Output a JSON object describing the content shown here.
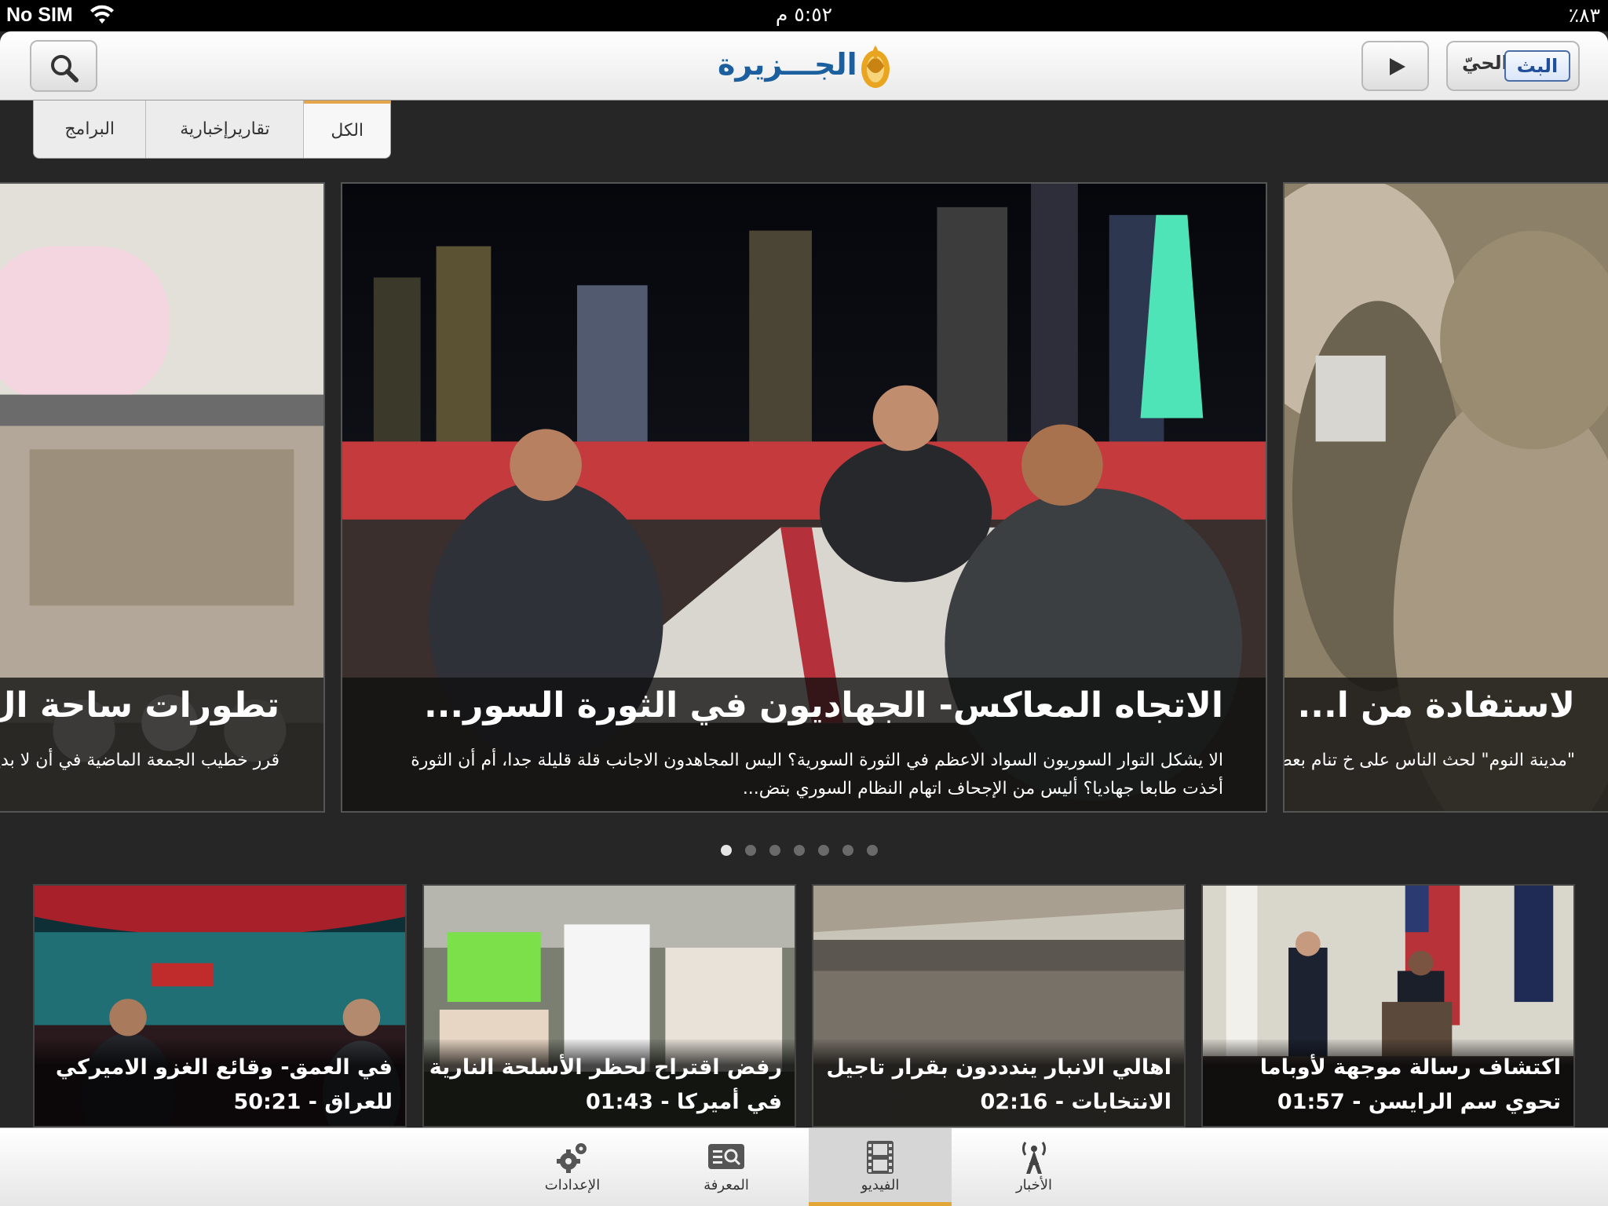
{
  "status_bar": {
    "carrier": "No SIM",
    "time": "٥:٥٢ م",
    "battery": "٪٨٣"
  },
  "header": {
    "logo_text": "الجـــزيرة",
    "live_label": "البث",
    "live_word": "الحيّ"
  },
  "tabs": [
    {
      "label": "البرامج"
    },
    {
      "label": "تقاريرإخبارية"
    },
    {
      "label": "الكل"
    }
  ],
  "featured": {
    "main": {
      "headline": "الاتجاه المعاكس- الجهاديون في الثورة السور...",
      "summary": "الا يشكل التوار السوريون السواد الاعظم في الثورة السورية؟ اليس المجاهدون الاجانب قلة قليلة جدا، أم أن الثورة أخذت طابعا جهاديا؟ أليس من الإجحاف اتهام النظام السوري بتض..."
    },
    "left": {
      "headline": "تطورات ساحة ال",
      "summary": "قرر خطيب الجمعة الماضية في أن لا بديل عن تحقيق المطالب"
    },
    "right": {
      "headline": "لاستفادة من ا...",
      "summary": "\"مدينة النوم\" لحث الناس على خ تنام بعض أجزائه بسر..."
    }
  },
  "pagination": {
    "count": 7,
    "active_index": 0
  },
  "thumbnails": [
    {
      "title": "في العمق- وقائع الغزو الاميركي للعراق - 50:21"
    },
    {
      "title": "رفض اقتراح لحظر الأسلحة النارية في أميركا - 01:43"
    },
    {
      "title": "اهالي الانبار يندددون بقرار تاجيل الانتخابات - 02:16"
    },
    {
      "title": "اكتشاف رسالة موجهة لأوباما تحوي سم الرايسن - 01:57"
    }
  ],
  "tabbar": [
    {
      "label": "الأخبار",
      "icon": "broadcast-tower-icon"
    },
    {
      "label": "الفيديو",
      "icon": "film-icon",
      "active": true
    },
    {
      "label": "المعرفة",
      "icon": "knowledge-search-icon"
    },
    {
      "label": "الإعدادات",
      "icon": "gears-icon"
    }
  ],
  "colors": {
    "accent": "#e2a637",
    "logo_blue": "#1b5f9e",
    "live_blue": "#1f4f9a",
    "background": "#262626"
  }
}
